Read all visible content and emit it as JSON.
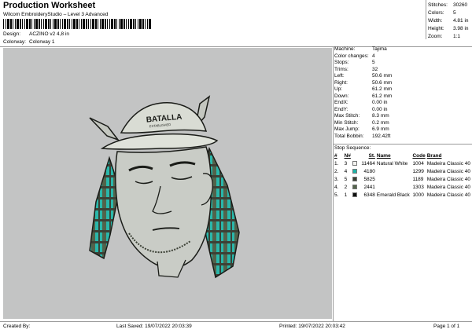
{
  "header": {
    "title": "Production Worksheet",
    "software": "Wilcom EmbroideryStudio – Level 3 Advanced",
    "design_label": "Design:",
    "design_value": "ACZINO v2 4,8 in",
    "colorway_label": "Colorway:",
    "colorway_value": "Colorway 1"
  },
  "stats": [
    {
      "label": "Stitches:",
      "value": "30260"
    },
    {
      "label": "Colors:",
      "value": "5"
    },
    {
      "label": "Width:",
      "value": "4.81 in"
    },
    {
      "label": "Height:",
      "value": "3.98 in"
    },
    {
      "label": "Zoom:",
      "value": "1:1"
    }
  ],
  "machine_info": [
    {
      "label": "Machine:",
      "value": "Tajima"
    },
    {
      "label": "Color changes:",
      "value": "4"
    },
    {
      "label": "Stops:",
      "value": "5"
    },
    {
      "label": "Trims:",
      "value": "32"
    },
    {
      "label": "Left:",
      "value": "50.6 mm"
    },
    {
      "label": "Right:",
      "value": "50.6 mm"
    },
    {
      "label": "Up:",
      "value": "61.2 mm"
    },
    {
      "label": "Down:",
      "value": "61.2 mm"
    },
    {
      "label": "EndX:",
      "value": "0.00 in"
    },
    {
      "label": "EndY:",
      "value": "0.00 in"
    },
    {
      "label": "Max Stitch:",
      "value": "8.3 mm"
    },
    {
      "label": "Min Stitch:",
      "value": "0.2 mm"
    },
    {
      "label": "Max Jump:",
      "value": "6.9 mm"
    },
    {
      "label": "Total Bobbin:",
      "value": "192.42ft"
    }
  ],
  "stop_sequence": {
    "label": "Stop Sequence:",
    "headers": [
      "#",
      "N#",
      "",
      "St.",
      "Name",
      "Code",
      "Brand"
    ],
    "rows": [
      {
        "num": "1.",
        "needle": "3",
        "color": "#f2f2ee",
        "stitches": "11464",
        "name": "Natural White",
        "code": "1004",
        "brand": "Madeira Classic 40"
      },
      {
        "num": "2.",
        "needle": "4",
        "color": "#1fb3a8",
        "stitches": "4180",
        "name": "",
        "code": "1299",
        "brand": "Madeira Classic 40"
      },
      {
        "num": "3.",
        "needle": "5",
        "color": "#3b3f33",
        "stitches": "5825",
        "name": "",
        "code": "1189",
        "brand": "Madeira Classic 40"
      },
      {
        "num": "4.",
        "needle": "2",
        "color": "#54644c",
        "stitches": "2441",
        "name": "",
        "code": "1303",
        "brand": "Madeira Classic 40"
      },
      {
        "num": "5.",
        "needle": "1",
        "color": "#0e0f0e",
        "stitches": "6348",
        "name": "Emerald Black",
        "code": "1000",
        "brand": "Madeira Classic 40"
      }
    ]
  },
  "design_art": {
    "cap_text_top": "BATALLA",
    "cap_text_bottom": "ESTABLISHED"
  },
  "footer": {
    "created_by": "Created By:",
    "last_saved": "Last Saved: 19/07/2022 20:03:39",
    "printed": "Printed: 19/07/2022 20:03:42",
    "page": "Page 1 of 1"
  }
}
